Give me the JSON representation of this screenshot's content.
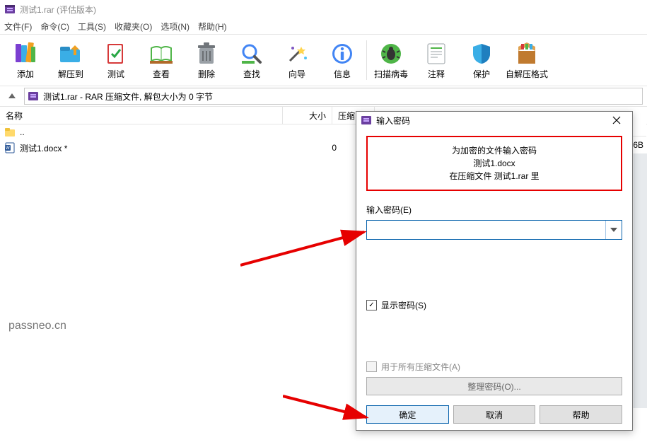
{
  "window": {
    "title": "测试1.rar (评估版本)"
  },
  "menu": {
    "file": "文件(F)",
    "cmd": "命令(C)",
    "tools": "工具(S)",
    "fav": "收藏夹(O)",
    "options": "选项(N)",
    "help": "帮助(H)"
  },
  "toolbar": {
    "add": "添加",
    "extract": "解压到",
    "test": "测试",
    "view": "查看",
    "del": "删除",
    "find": "查找",
    "wizard": "向导",
    "info": "信息",
    "scan": "扫描病毒",
    "comment": "注释",
    "protect": "保护",
    "sfx": "自解压格式"
  },
  "address": {
    "path": "测试1.rar - RAR 压缩文件, 解包大小为 0 字节"
  },
  "columns": {
    "name": "名称",
    "size": "大小",
    "packed": "压缩"
  },
  "rows": {
    "up": "..",
    "file1": {
      "name": "测试1.docx *",
      "size": "0"
    }
  },
  "behind": {
    "tail": "6B"
  },
  "dialog": {
    "title": "输入密码",
    "msg_line1": "为加密的文件输入密码",
    "msg_line2": "测试1.docx",
    "msg_line3": "在压缩文件 测试1.rar 里",
    "enter_label": "输入密码(E)",
    "show_pw": "显示密码(S)",
    "use_all": "用于所有压缩文件(A)",
    "manage": "整理密码(O)...",
    "ok": "确定",
    "cancel": "取消",
    "help": "帮助",
    "pw_value": ""
  },
  "watermark": "passneo.cn"
}
